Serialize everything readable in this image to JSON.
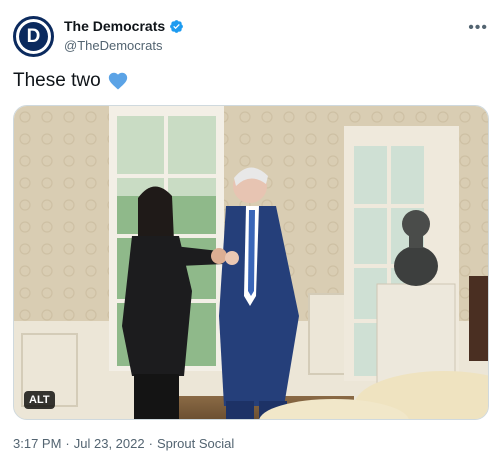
{
  "author": {
    "display_name": "The Democrats",
    "handle": "@TheDemocrats",
    "avatar_letter": "D",
    "brand_color": "#0b2a5e",
    "verified": true,
    "verified_color": "#1d9bf0"
  },
  "menu": {
    "more_icon": "more-horizontal-icon"
  },
  "tweet": {
    "text": "These two",
    "emoji": "blue-heart-icon",
    "emoji_color": "#5ba3e6"
  },
  "media": {
    "alt_label": "ALT"
  },
  "meta": {
    "time": "3:17 PM",
    "date": "Jul 23, 2022",
    "source": "Sprout Social",
    "separator": "·"
  }
}
